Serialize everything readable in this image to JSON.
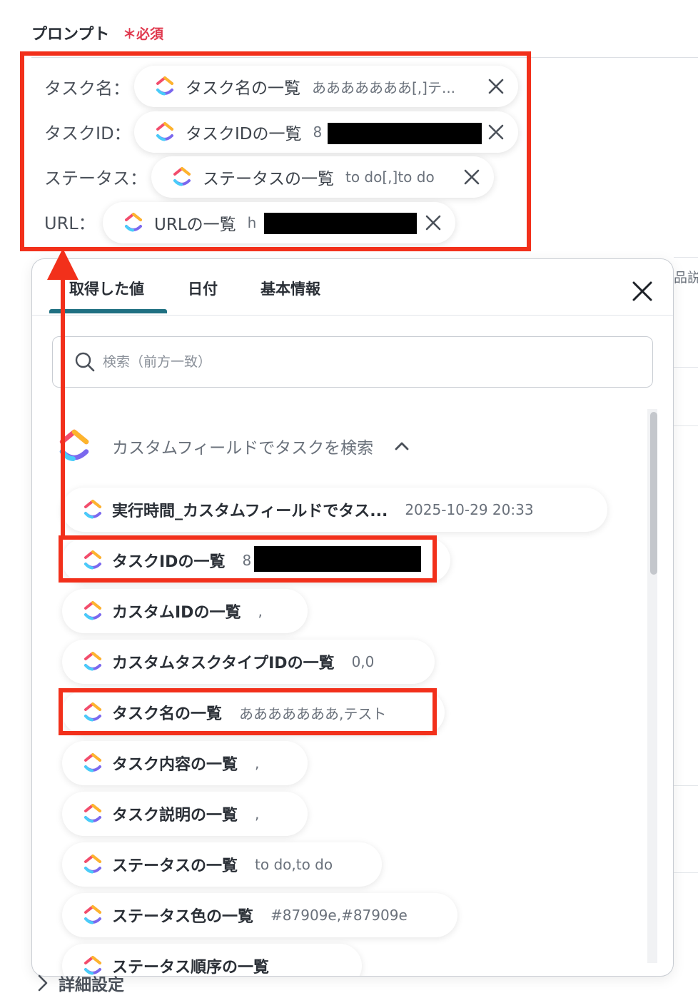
{
  "prompt": {
    "label": "プロンプト",
    "required": "＊必須"
  },
  "fields": [
    {
      "label": "タスク名：",
      "pill_title": "タスク名の一覧",
      "pill_value": "あああああああ[,]テ..."
    },
    {
      "label": "タスクID：",
      "pill_title": "タスクIDの一覧",
      "pill_value": "8"
    },
    {
      "label": "ステータス：",
      "pill_title": "ステータスの一覧",
      "pill_value": "to do[,]to do"
    },
    {
      "label": "URL：",
      "pill_title": "URLの一覧",
      "pill_value": "h"
    }
  ],
  "popup": {
    "tabs": [
      "取得した値",
      "日付",
      "基本情報"
    ],
    "search_placeholder": "検索（前方一致）",
    "group_title": "カスタムフィールドでタスクを検索",
    "items": [
      {
        "title": "実行時間_カスタムフィールドでタス...",
        "value": "2025-10-29 20:33"
      },
      {
        "title": "タスクIDの一覧",
        "value": "8"
      },
      {
        "title": "カスタムIDの一覧",
        "value": ","
      },
      {
        "title": "カスタムタスクタイプIDの一覧",
        "value": "0,0"
      },
      {
        "title": "タスク名の一覧",
        "value": "あああああああ,テスト"
      },
      {
        "title": "タスク内容の一覧",
        "value": ","
      },
      {
        "title": "タスク説明の一覧",
        "value": ","
      },
      {
        "title": "ステータスの一覧",
        "value": "to do,to do"
      },
      {
        "title": "ステータス色の一覧",
        "value": "#87909e,#87909e"
      },
      {
        "title": "ステータス順序の一覧",
        "value": ""
      }
    ]
  },
  "background_text": "品説",
  "detail_settings": "詳細設定",
  "colors": {
    "highlight_red": "#f2301b",
    "accent_teal": "#1f7082",
    "required_red": "#e03a4f"
  },
  "icons": {
    "app": "clickup-logo-icon",
    "close": "close-icon",
    "search": "search-icon",
    "chevron_up": "chevron-up-icon",
    "chevron_right": "chevron-right-icon"
  }
}
